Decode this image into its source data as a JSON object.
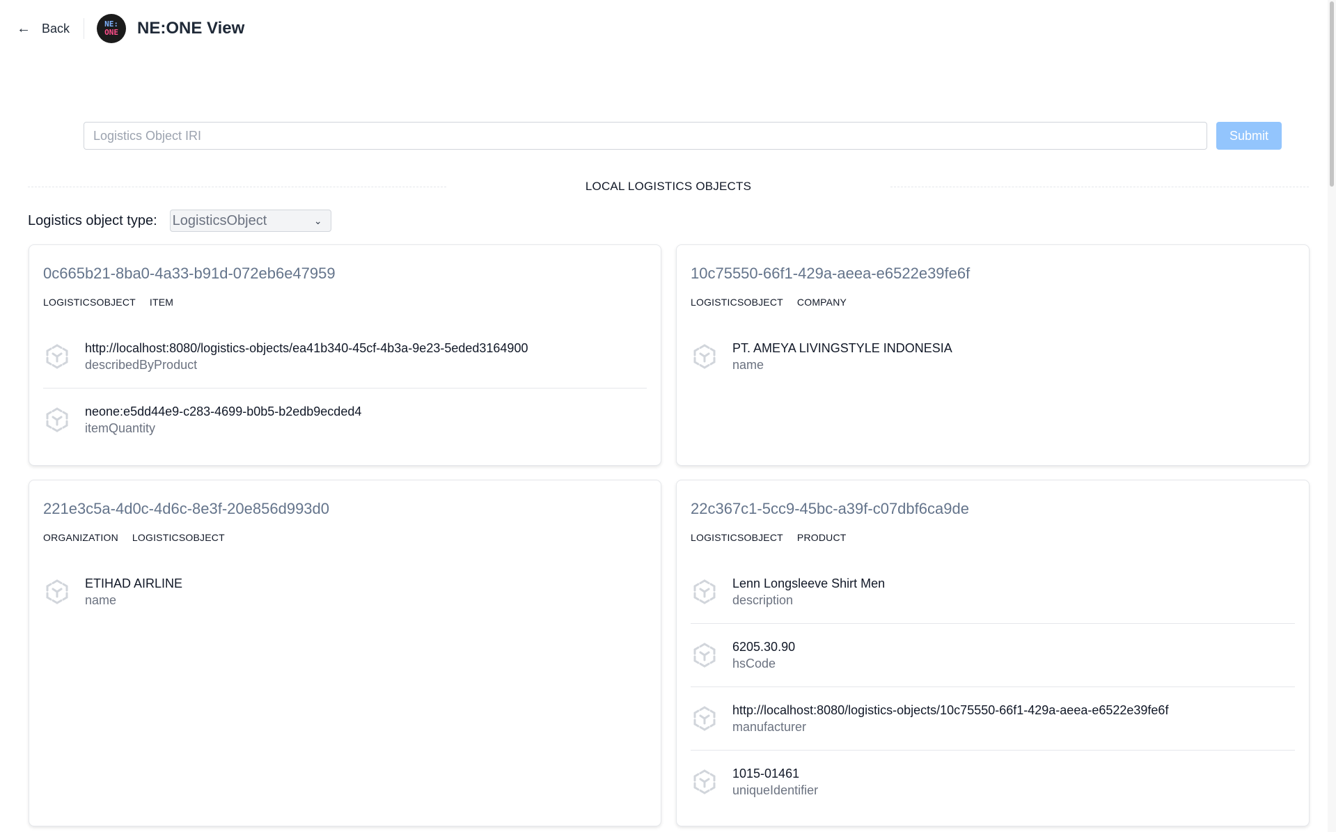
{
  "header": {
    "back_label": "Back",
    "logo_line1": "NE:",
    "logo_line2": "ONE",
    "app_title": "NE:ONE View"
  },
  "search": {
    "placeholder": "Logistics Object IRI",
    "value": "",
    "submit_label": "Submit"
  },
  "section": {
    "title": "LOCAL LOGISTICS OBJECTS"
  },
  "filter": {
    "label": "Logistics object type:",
    "selected": "LogisticsObject"
  },
  "cards": [
    {
      "title": "0c665b21-8ba0-4a33-b91d-072eb6e47959",
      "tags": [
        "LOGISTICSOBJECT",
        "ITEM"
      ],
      "props": [
        {
          "value": "http://localhost:8080/logistics-objects/ea41b340-45cf-4b3a-9e23-5eded3164900",
          "key": "describedByProduct"
        },
        {
          "value": "neone:e5dd44e9-c283-4699-b0b5-b2edb9ecded4",
          "key": "itemQuantity"
        }
      ]
    },
    {
      "title": "10c75550-66f1-429a-aeea-e6522e39fe6f",
      "tags": [
        "LOGISTICSOBJECT",
        "COMPANY"
      ],
      "props": [
        {
          "value": "PT. AMEYA LIVINGSTYLE INDONESIA",
          "key": "name"
        }
      ]
    },
    {
      "title": "221e3c5a-4d0c-4d6c-8e3f-20e856d993d0",
      "tags": [
        "ORGANIZATION",
        "LOGISTICSOBJECT"
      ],
      "props": [
        {
          "value": "ETIHAD AIRLINE",
          "key": "name"
        }
      ]
    },
    {
      "title": "22c367c1-5cc9-45bc-a39f-c07dbf6ca9de",
      "tags": [
        "LOGISTICSOBJECT",
        "PRODUCT"
      ],
      "props": [
        {
          "value": "Lenn Longsleeve Shirt Men",
          "key": "description"
        },
        {
          "value": "6205.30.90",
          "key": "hsCode"
        },
        {
          "value": "http://localhost:8080/logistics-objects/10c75550-66f1-429a-aeea-e6522e39fe6f",
          "key": "manufacturer"
        },
        {
          "value": "1015-01461",
          "key": "uniqueIdentifier"
        }
      ]
    }
  ],
  "icons": {
    "back": "arrow-left-icon",
    "property": "cube-icon",
    "select": "chevron-down-icon"
  },
  "colors": {
    "submit_bg": "#93c5fd",
    "card_title": "#64748b"
  }
}
